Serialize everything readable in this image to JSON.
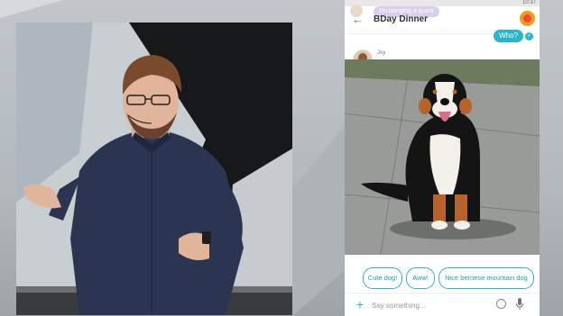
{
  "phone": {
    "status_time": "10:37",
    "notification": "I'm bringing a guest",
    "header_title": "BDay Dinner",
    "outgoing_message": "Who?",
    "sender_name": "Joy",
    "suggestions": [
      "Cute dog!",
      "Aww!",
      "Nice bernese mountain dog"
    ],
    "composer_placeholder": "Say something..."
  },
  "colors": {
    "accent": "#2bb5c9",
    "background": "#b6bbc0"
  }
}
